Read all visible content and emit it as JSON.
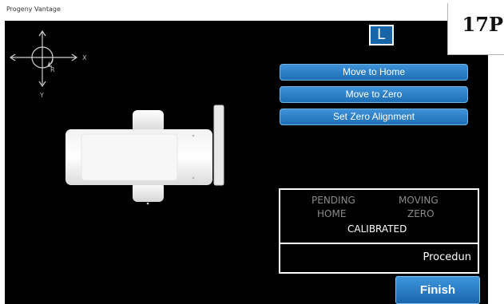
{
  "window": {
    "title": "Progeny Vantage"
  },
  "badge": {
    "label": "17P"
  },
  "side_button": {
    "label": "L"
  },
  "axis": {
    "x_label": "X",
    "y_label": "Y",
    "r_label": "R"
  },
  "actions": [
    {
      "label": "Move to Home"
    },
    {
      "label": "Move to Zero"
    },
    {
      "label": "Set Zero Alignment"
    }
  ],
  "status": {
    "pending": "PENDING",
    "moving": "MOVING",
    "home": "HOME",
    "zero": "ZERO",
    "calibrated": "CALIBRATED"
  },
  "procedure": {
    "label": "Procedun"
  },
  "finish": {
    "label": "Finish"
  },
  "colors": {
    "background": "#000000",
    "button": "#2a7fc6",
    "status_inactive": "#8a8a8a",
    "status_active": "#ffffff"
  }
}
